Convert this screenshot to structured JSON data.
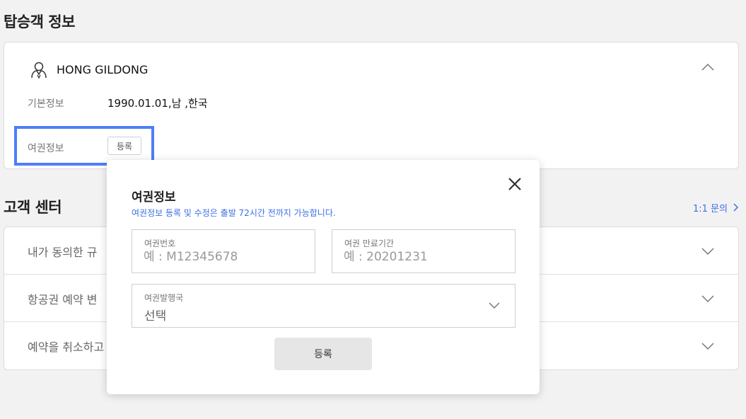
{
  "passenger_section": {
    "title": "탑승객 정보",
    "name": "HONG GILDONG",
    "basic_info_label": "기본정보",
    "basic_info_value": "1990.01.01,남 ,한국",
    "passport_info_label": "여권정보",
    "register_label": "등록"
  },
  "customer_center": {
    "title": "고객 센터",
    "inquiry_link": "1:1 문의",
    "rows": [
      {
        "label": "내가 동의한 규"
      },
      {
        "label": "항공권 예약 변"
      },
      {
        "label": "예약을 취소하고"
      }
    ]
  },
  "modal": {
    "title": "여권정보",
    "notice": "여권정보 등록 및 수정은 출발 72시간 전까지 가능합니다.",
    "passport_number": {
      "label": "여권번호",
      "placeholder": "예 : M12345678",
      "value": ""
    },
    "expiry": {
      "label": "여권 만료기간",
      "placeholder": "예 : 20201231",
      "value": ""
    },
    "country": {
      "label": "여권발행국",
      "value": "선택"
    },
    "register_button": "등록"
  },
  "colors": {
    "accent": "#3d6fe5",
    "highlight_border": "#4f7dfa",
    "background": "#f2f2f2"
  },
  "icons": {
    "passenger": "person-icon",
    "collapse": "chevron-up-icon",
    "expand": "chevron-down-icon",
    "close": "close-icon",
    "link_arrow": "chevron-right-icon"
  }
}
